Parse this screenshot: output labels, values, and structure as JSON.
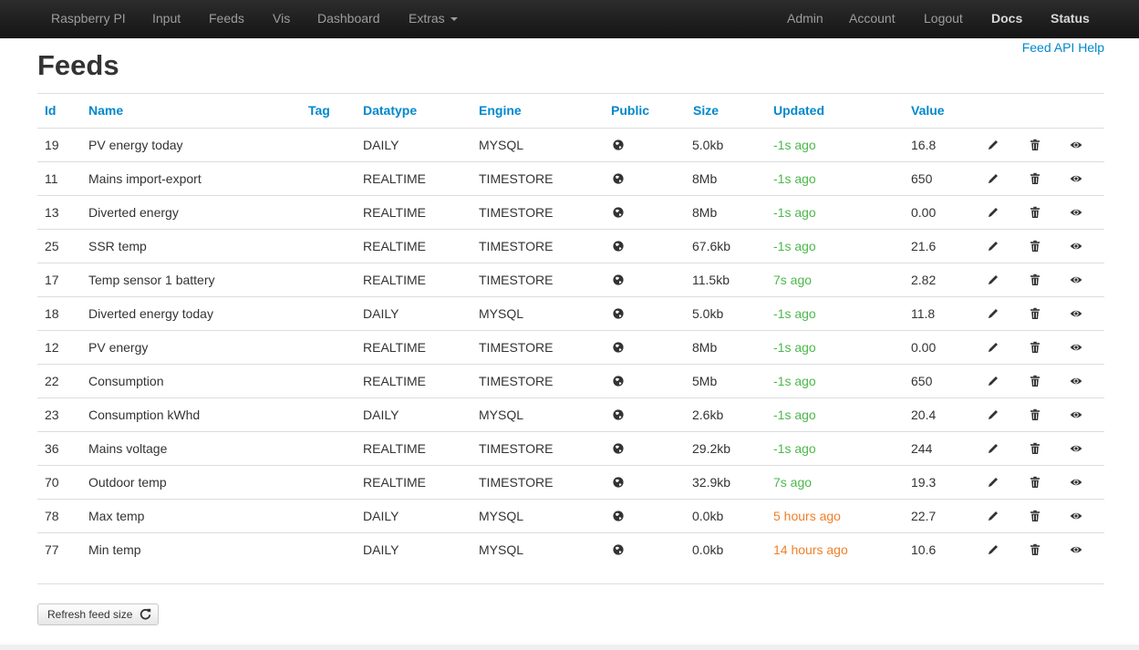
{
  "nav": {
    "left": [
      {
        "label": "Raspberry PI"
      },
      {
        "label": "Input"
      },
      {
        "label": "Feeds"
      },
      {
        "label": "Vis"
      },
      {
        "label": "Dashboard"
      },
      {
        "label": "Extras"
      }
    ],
    "right": [
      {
        "label": "Admin"
      },
      {
        "label": "Account"
      },
      {
        "label": "Logout"
      },
      {
        "label": "Docs"
      },
      {
        "label": "Status"
      }
    ]
  },
  "page": {
    "title": "Feeds",
    "api_help": "Feed API Help"
  },
  "table": {
    "columns": [
      "Id",
      "Name",
      "Tag",
      "Datatype",
      "Engine",
      "Public",
      "Size",
      "Updated",
      "Value"
    ],
    "rows": [
      {
        "id": "19",
        "name": "PV energy today",
        "tag": "",
        "datatype": "DAILY",
        "engine": "MYSQL",
        "size": "5.0kb",
        "updated": "-1s ago",
        "updated_status": "green",
        "value": "16.8"
      },
      {
        "id": "11",
        "name": "Mains import-export",
        "tag": "",
        "datatype": "REALTIME",
        "engine": "TIMESTORE",
        "size": "8Mb",
        "updated": "-1s ago",
        "updated_status": "green",
        "value": "650"
      },
      {
        "id": "13",
        "name": "Diverted energy",
        "tag": "",
        "datatype": "REALTIME",
        "engine": "TIMESTORE",
        "size": "8Mb",
        "updated": "-1s ago",
        "updated_status": "green",
        "value": "0.00"
      },
      {
        "id": "25",
        "name": "SSR temp",
        "tag": "",
        "datatype": "REALTIME",
        "engine": "TIMESTORE",
        "size": "67.6kb",
        "updated": "-1s ago",
        "updated_status": "green",
        "value": "21.6"
      },
      {
        "id": "17",
        "name": "Temp sensor 1 battery",
        "tag": "",
        "datatype": "REALTIME",
        "engine": "TIMESTORE",
        "size": "11.5kb",
        "updated": "7s ago",
        "updated_status": "green",
        "value": "2.82"
      },
      {
        "id": "18",
        "name": "Diverted energy today",
        "tag": "",
        "datatype": "DAILY",
        "engine": "MYSQL",
        "size": "5.0kb",
        "updated": "-1s ago",
        "updated_status": "green",
        "value": "11.8"
      },
      {
        "id": "12",
        "name": "PV energy",
        "tag": "",
        "datatype": "REALTIME",
        "engine": "TIMESTORE",
        "size": "8Mb",
        "updated": "-1s ago",
        "updated_status": "green",
        "value": "0.00"
      },
      {
        "id": "22",
        "name": "Consumption",
        "tag": "",
        "datatype": "REALTIME",
        "engine": "TIMESTORE",
        "size": "5Mb",
        "updated": "-1s ago",
        "updated_status": "green",
        "value": "650"
      },
      {
        "id": "23",
        "name": "Consumption kWhd",
        "tag": "",
        "datatype": "DAILY",
        "engine": "MYSQL",
        "size": "2.6kb",
        "updated": "-1s ago",
        "updated_status": "green",
        "value": "20.4"
      },
      {
        "id": "36",
        "name": "Mains voltage",
        "tag": "",
        "datatype": "REALTIME",
        "engine": "TIMESTORE",
        "size": "29.2kb",
        "updated": "-1s ago",
        "updated_status": "green",
        "value": "244"
      },
      {
        "id": "70",
        "name": "Outdoor temp",
        "tag": "",
        "datatype": "REALTIME",
        "engine": "TIMESTORE",
        "size": "32.9kb",
        "updated": "7s ago",
        "updated_status": "green",
        "value": "19.3"
      },
      {
        "id": "78",
        "name": "Max temp",
        "tag": "",
        "datatype": "DAILY",
        "engine": "MYSQL",
        "size": "0.0kb",
        "updated": "5 hours ago",
        "updated_status": "orange",
        "value": "22.7"
      },
      {
        "id": "77",
        "name": "Min temp",
        "tag": "",
        "datatype": "DAILY",
        "engine": "MYSQL",
        "size": "0.0kb",
        "updated": "14 hours ago",
        "updated_status": "orange",
        "value": "10.6"
      }
    ],
    "row_icons": [
      "globe-icon",
      "pencil-icon",
      "trash-icon",
      "eye-icon"
    ]
  },
  "footer": {
    "refresh_label": "Refresh feed size",
    "refresh_icon": "refresh-icon"
  },
  "colors": {
    "link": "#0088cc",
    "fresh": "#4cb84c",
    "stale": "#f0802a",
    "navbar": "#1b1b1b"
  }
}
